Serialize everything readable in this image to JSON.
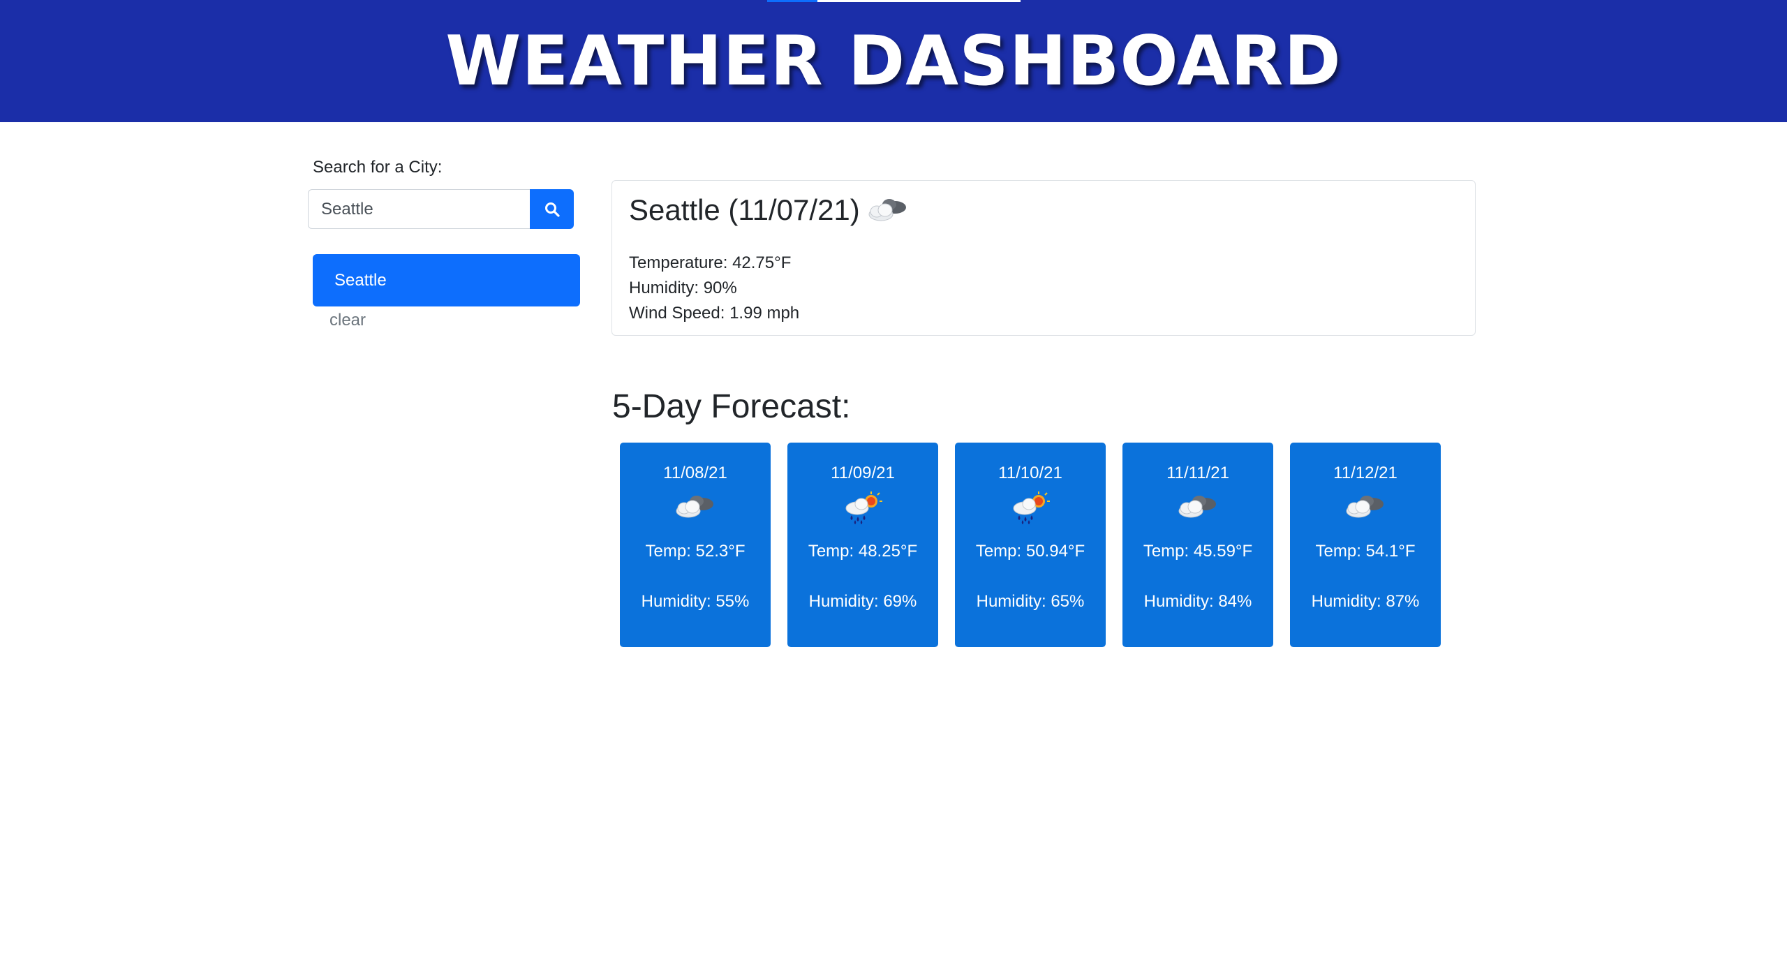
{
  "header": {
    "title": "WEATHER DASHBOARD"
  },
  "sidebar": {
    "search_label": "Search for a City:",
    "search_value": "Seattle",
    "search_button_icon": "search-icon",
    "history": [
      {
        "label": "Seattle"
      }
    ],
    "clear_label": "clear"
  },
  "current": {
    "title": "Seattle (11/07/21)",
    "icon": "broken-clouds-icon",
    "temperature": "Temperature: 42.75°F",
    "humidity": "Humidity: 90%",
    "wind": "Wind Speed: 1.99 mph"
  },
  "forecast": {
    "heading": "5-Day Forecast:",
    "days": [
      {
        "date": "11/08/21",
        "icon": "broken-clouds-icon",
        "temp": "Temp: 52.3°F",
        "humidity": "Humidity: 55%"
      },
      {
        "date": "11/09/21",
        "icon": "rain-sun-icon",
        "temp": "Temp: 48.25°F",
        "humidity": "Humidity: 69%"
      },
      {
        "date": "11/10/21",
        "icon": "rain-sun-icon",
        "temp": "Temp: 50.94°F",
        "humidity": "Humidity: 65%"
      },
      {
        "date": "11/11/21",
        "icon": "broken-clouds-icon",
        "temp": "Temp: 45.59°F",
        "humidity": "Humidity: 84%"
      },
      {
        "date": "11/12/21",
        "icon": "broken-clouds-icon",
        "temp": "Temp: 54.1°F",
        "humidity": "Humidity: 87%"
      }
    ]
  },
  "colors": {
    "header_bg": "#1b2ea8",
    "primary": "#0d6efd",
    "card_bg": "#0b72db"
  }
}
